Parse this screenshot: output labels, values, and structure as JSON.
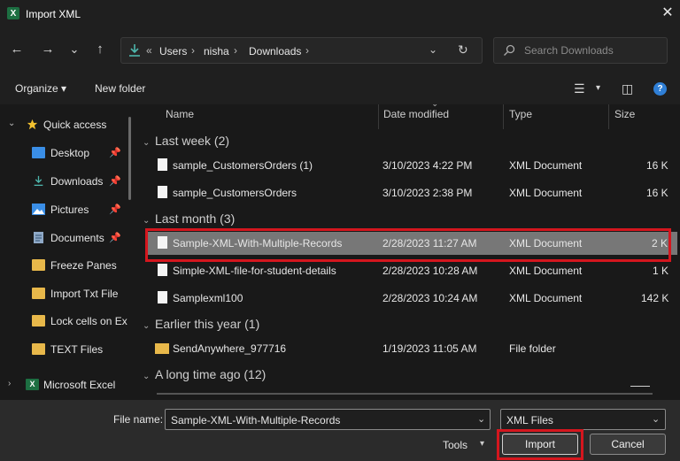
{
  "window": {
    "app_icon_letter": "X",
    "title": "Import XML",
    "close_glyph": "✕"
  },
  "nav": {
    "back_glyph": "←",
    "forward_glyph": "→",
    "recent_glyph": "⌄",
    "up_glyph": "↑",
    "address_overflow": "«",
    "breadcrumbs": [
      "Users",
      "nisha",
      "Downloads"
    ],
    "crumb_sep": "›",
    "address_drop": "⌄",
    "refresh_glyph": "↻",
    "search_placeholder": "Search Downloads"
  },
  "toolbar": {
    "organize_label": "Organize ▾",
    "new_folder_label": "New folder",
    "view_glyph": "☰",
    "view_drop": "▾",
    "pane_glyph": "◫",
    "help_glyph": "?"
  },
  "sidebar": {
    "items": [
      {
        "label": "Quick access",
        "icon": "star-icon",
        "chevron": "⌄",
        "pinned": false
      },
      {
        "label": "Desktop",
        "icon": "desktop-icon",
        "pin": "📌"
      },
      {
        "label": "Downloads",
        "icon": "download-icon",
        "pin": "📌"
      },
      {
        "label": "Pictures",
        "icon": "pictures-icon",
        "pin": "📌"
      },
      {
        "label": "Documents",
        "icon": "documents-icon",
        "pin": "📌"
      },
      {
        "label": "Freeze Panes",
        "icon": "folder-icon"
      },
      {
        "label": "Import Txt File",
        "icon": "folder-icon"
      },
      {
        "label": "Lock cells on Ex",
        "icon": "folder-icon"
      },
      {
        "label": "TEXT Files",
        "icon": "folder-icon"
      },
      {
        "label": "Microsoft Excel",
        "icon": "excel-icon",
        "chevron": "›"
      }
    ]
  },
  "columns": {
    "name": "Name",
    "date_modified": "Date modified",
    "type": "Type",
    "size": "Size",
    "sort_glyph": "⌄"
  },
  "groups": [
    {
      "label": "Last week (2)",
      "chevron": "⌄"
    },
    {
      "label": "Last month (3)",
      "chevron": "⌄"
    },
    {
      "label": "Earlier this year (1)",
      "chevron": "⌄"
    },
    {
      "label": "A long time ago (12)",
      "chevron": "⌄"
    }
  ],
  "files": [
    {
      "name": "sample_CustomersOrders (1)",
      "date": "3/10/2023 4:22 PM",
      "type": "XML Document",
      "size": "16 K"
    },
    {
      "name": "sample_CustomersOrders",
      "date": "3/10/2023 2:38 PM",
      "type": "XML Document",
      "size": "16 K"
    },
    {
      "name": "Sample-XML-With-Multiple-Records",
      "date": "2/28/2023 11:27 AM",
      "type": "XML Document",
      "size": "2 K"
    },
    {
      "name": "Simple-XML-file-for-student-details",
      "date": "2/28/2023 10:28 AM",
      "type": "XML Document",
      "size": "1 K"
    },
    {
      "name": "Samplexml100",
      "date": "2/28/2023 10:24 AM",
      "type": "XML Document",
      "size": "142 K"
    },
    {
      "name": "SendAnywhere_977716",
      "date": "1/19/2023 11:05 AM",
      "type": "File folder",
      "size": ""
    }
  ],
  "bottom": {
    "file_name_label": "File name:",
    "file_name_value": "Sample-XML-With-Multiple-Records",
    "file_type_value": "XML Files",
    "drop_glyph": "⌄",
    "tools_label": "Tools",
    "tools_drop": "▾",
    "import_label": "Import",
    "cancel_label": "Cancel"
  },
  "colors": {
    "highlight": "#d5161e",
    "selected_row": "#777777",
    "folder": "#e8b84a",
    "accent_download": "#4db6ac"
  }
}
